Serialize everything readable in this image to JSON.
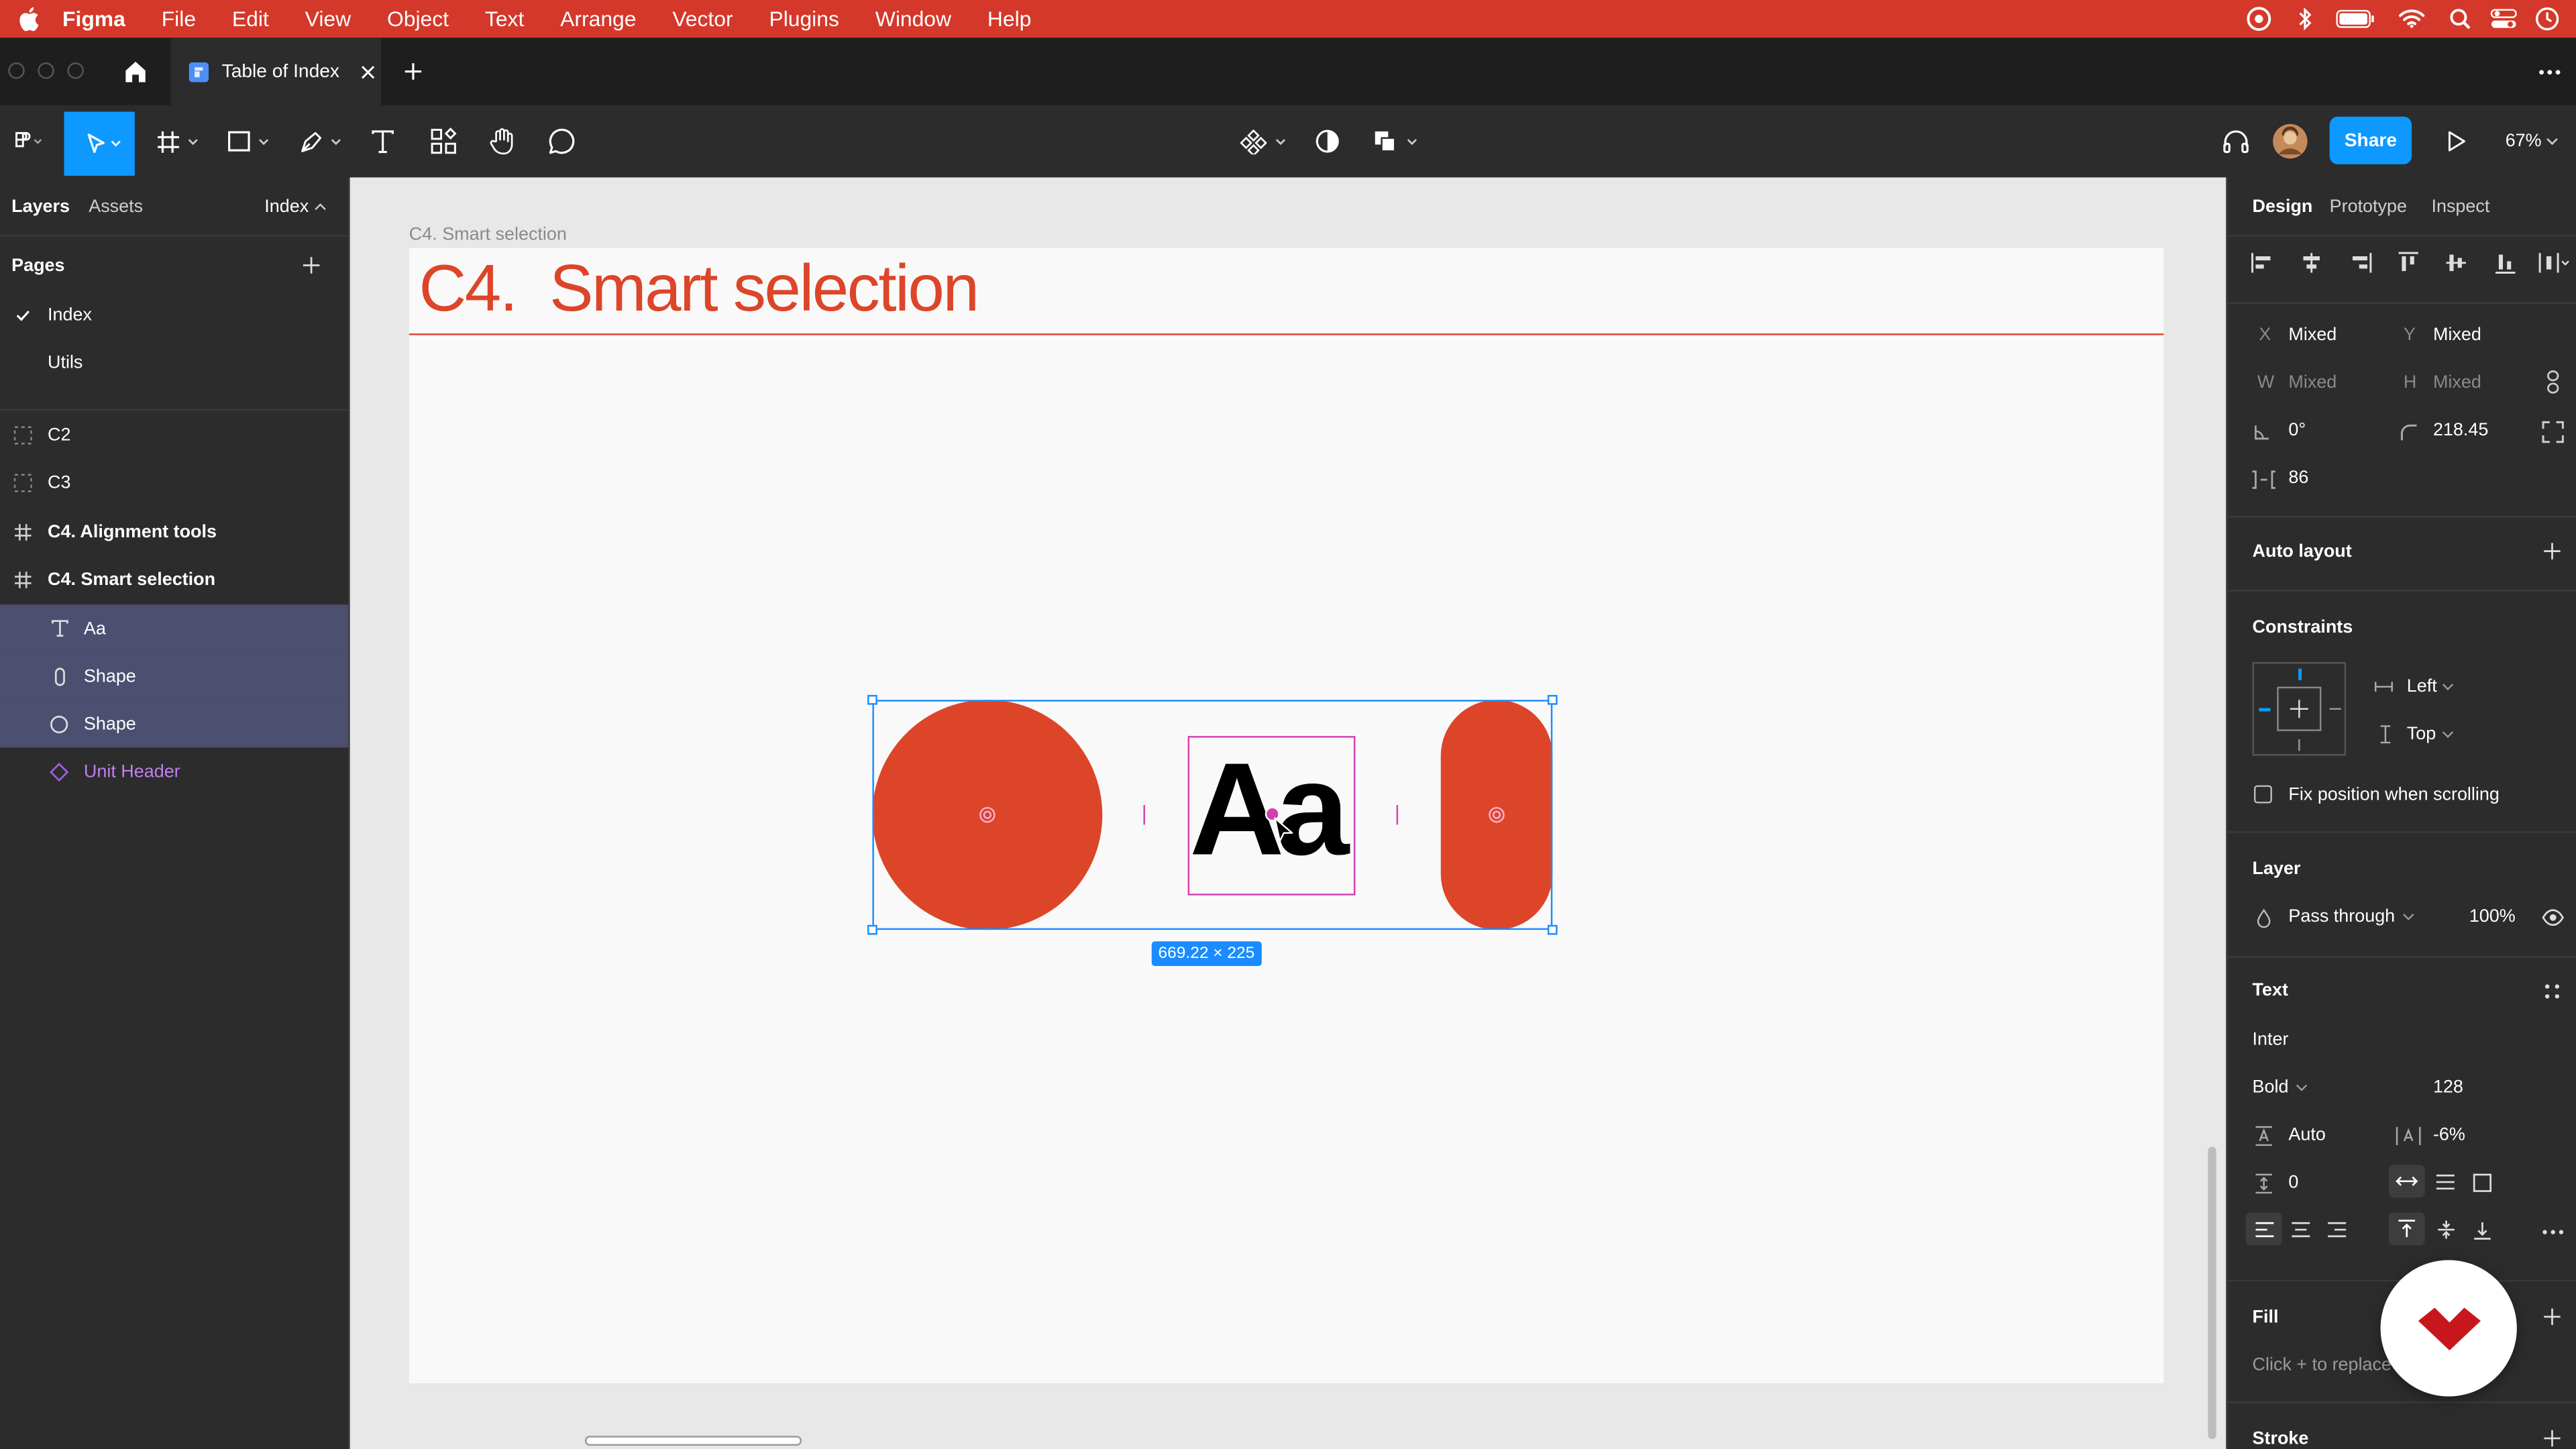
{
  "menubar": {
    "app_name": "Figma",
    "items": [
      "File",
      "Edit",
      "View",
      "Object",
      "Text",
      "Arrange",
      "Vector",
      "Plugins",
      "Window",
      "Help"
    ]
  },
  "tabbar": {
    "tab_title": "Table of Index"
  },
  "toolbar": {
    "share_label": "Share",
    "zoom": "67%"
  },
  "left_panel": {
    "tabs": [
      "Layers",
      "Assets"
    ],
    "page_selector": "Index",
    "pages_header": "Pages",
    "pages": [
      "Index",
      "Utils"
    ],
    "layers": [
      {
        "label": "C2",
        "icon": "section-icon"
      },
      {
        "label": "C3",
        "icon": "section-icon"
      },
      {
        "label": "C4. Alignment tools",
        "icon": "frame-icon"
      },
      {
        "label": "C4. Smart selection",
        "icon": "frame-icon"
      },
      {
        "label": "Aa",
        "icon": "text-icon"
      },
      {
        "label": "Shape",
        "icon": "rectangle-icon"
      },
      {
        "label": "Shape",
        "icon": "ellipse-icon"
      },
      {
        "label": "Unit Header",
        "icon": "component-icon"
      }
    ]
  },
  "canvas": {
    "frame_label": "C4. Smart selection",
    "frame_title": "C4.  Smart selection",
    "sample_text": "Aa",
    "selection_size": "669.22 × 225",
    "accent_color": "#dd4529",
    "selection_color": "#1a8cff",
    "text_selection_color": "#d43fb0"
  },
  "right_panel": {
    "tabs": [
      "Design",
      "Prototype",
      "Inspect"
    ],
    "x_label": "X",
    "x_value": "Mixed",
    "y_label": "Y",
    "y_value": "Mixed",
    "w_label": "W",
    "w_value": "Mixed",
    "h_label": "H",
    "h_value": "Mixed",
    "rotation": "0°",
    "corner_radius": "218.45",
    "spacing": "86",
    "auto_layout": "Auto layout",
    "constraints_title": "Constraints",
    "constraint_h": "Left",
    "constraint_v": "Top",
    "fix_position": "Fix position when scrolling",
    "layer_title": "Layer",
    "blend_mode": "Pass through",
    "opacity": "100%",
    "text_title": "Text",
    "font_family": "Inter",
    "font_weight": "Bold",
    "font_size": "128",
    "line_height": "Auto",
    "letter_spacing": "-6%",
    "paragraph_spacing": "0",
    "fill_title": "Fill",
    "fill_hint": "Click + to replace",
    "stroke_title": "Stroke"
  }
}
